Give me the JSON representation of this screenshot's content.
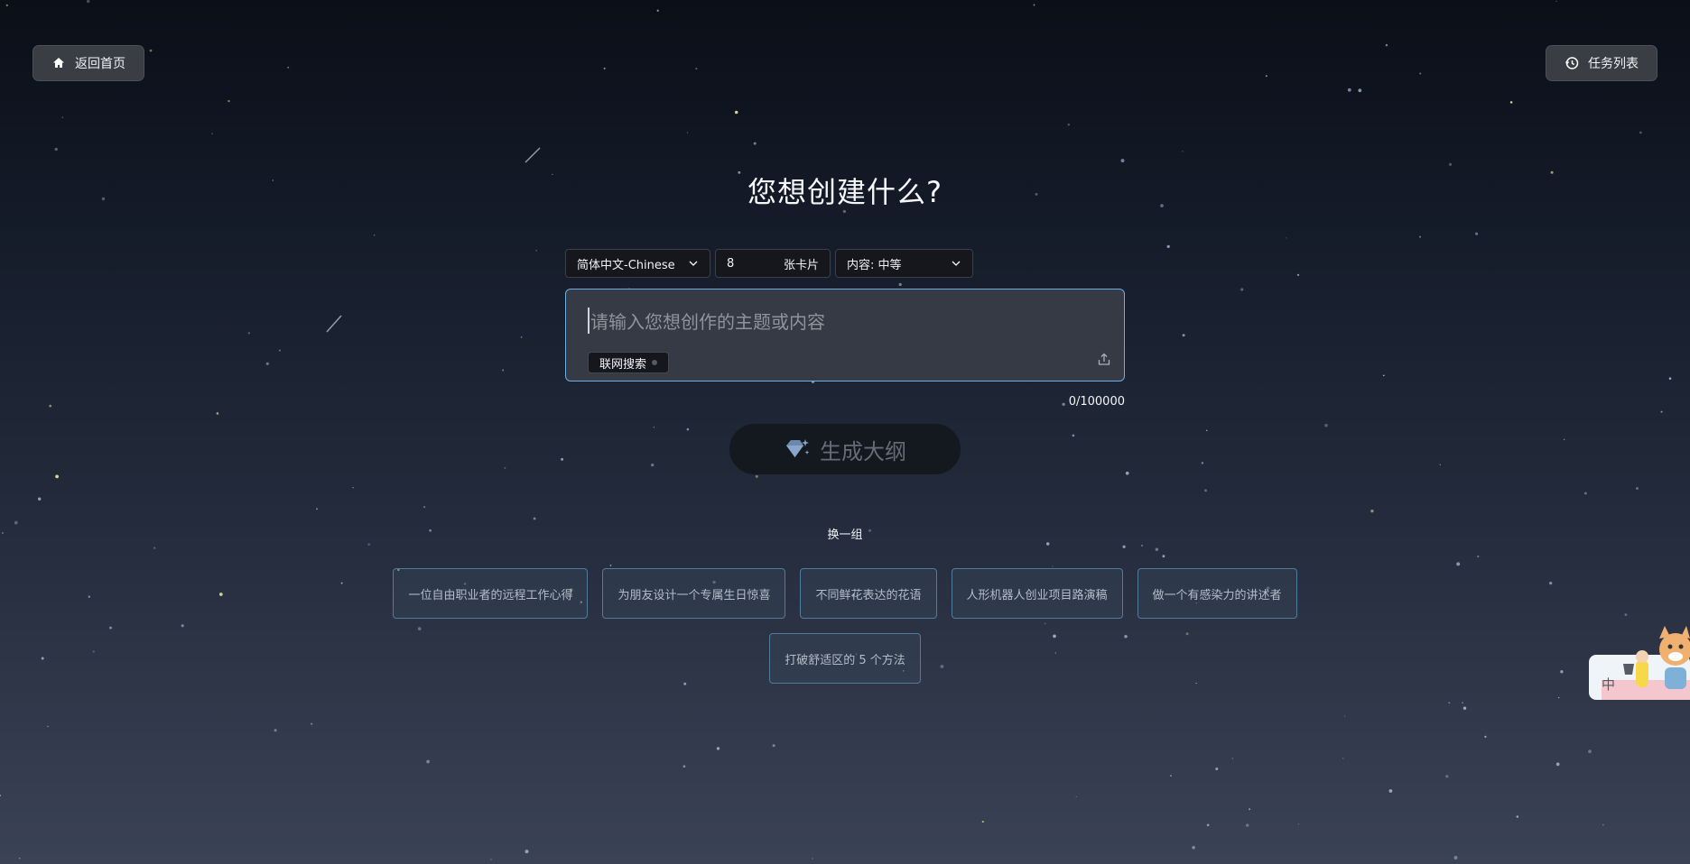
{
  "header": {
    "home_label": "返回首页",
    "tasks_label": "任务列表"
  },
  "title": "您想创建什么?",
  "controls": {
    "language": "简体中文-Chinese",
    "card_count": "8",
    "card_unit": "张卡片",
    "content_level": "内容: 中等"
  },
  "input": {
    "placeholder": "请输入您想创作的主题或内容",
    "web_search_label": "联网搜索",
    "counter": "0/100000"
  },
  "generate_label": "生成大纲",
  "refresh_label": "换一组",
  "suggestions": [
    "一位自由职业者的远程工作心得",
    "为朋友设计一个专属生日惊喜",
    "不同鲜花表达的花语",
    "人形机器人创业项目路演稿",
    "做一个有感染力的讲述者",
    "打破舒适区的 5 个方法"
  ],
  "mascot": {
    "badge": "中"
  },
  "colors": {
    "accent": "#6aaee8",
    "chip_border": "#4e7d9c"
  },
  "icons": {
    "home": "home-icon",
    "tasks": "history-icon",
    "upload": "upload-icon",
    "generate": "sparkle-diamond-icon"
  }
}
